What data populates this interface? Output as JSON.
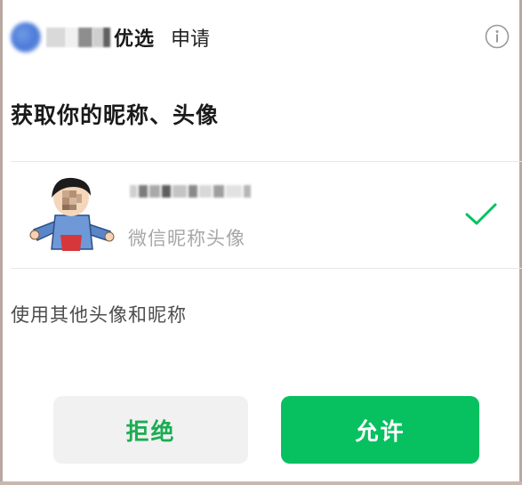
{
  "header": {
    "app_name": "优选",
    "apply_label": "申请",
    "logo_icon": "app-logo-icon",
    "info_icon": "info-icon"
  },
  "title": "获取你的昵称、头像",
  "option": {
    "subtitle": "微信昵称头像",
    "selected": true,
    "check_icon": "check-icon"
  },
  "other_link": "使用其他头像和昵称",
  "buttons": {
    "reject": "拒绝",
    "allow": "允许"
  },
  "colors": {
    "accent_green": "#07c160",
    "reject_text": "#1aad52",
    "reject_bg": "#f1f1f1"
  }
}
